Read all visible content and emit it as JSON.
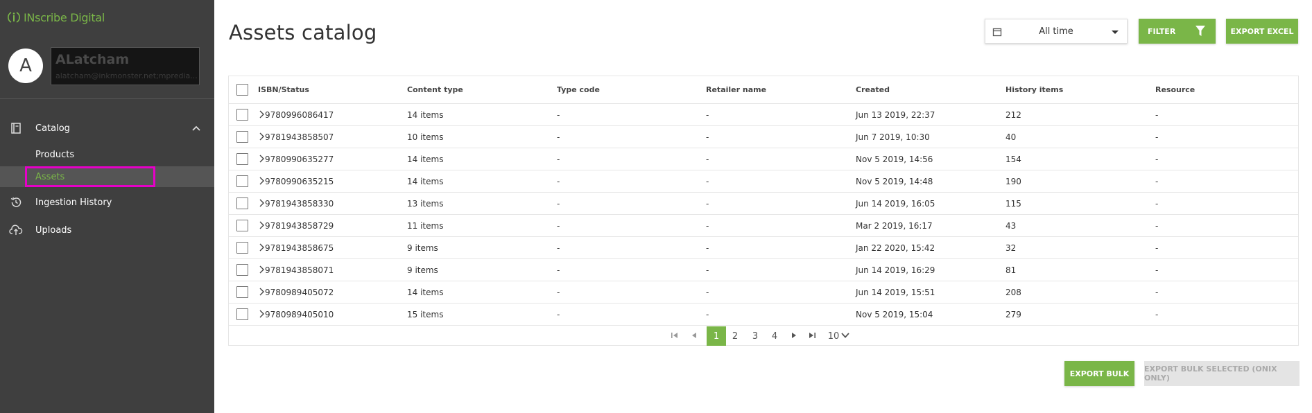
{
  "app": {
    "logo_text": "INscribe Digital",
    "accent": "#7ab648"
  },
  "user": {
    "initial": "A",
    "name": "ALatcham",
    "email": "alatcham@inkmonster.net;mpredia..."
  },
  "sidebar": {
    "catalog": "Catalog",
    "products": "Products",
    "assets": "Assets",
    "ingestion_history": "Ingestion History",
    "uploads": "Uploads"
  },
  "main": {
    "title": "Assets catalog",
    "date_filter": "All time",
    "filter_label": "FILTER",
    "export_excel_label": "EXPORT EXCEL",
    "export_bulk_label": "EXPORT BULK",
    "export_bulk_selected_label": "EXPORT BULK SELECTED (ONIX ONLY)"
  },
  "table": {
    "headers": [
      "ISBN/Status",
      "Content type",
      "Type code",
      "Retailer name",
      "Created",
      "History items",
      "Resource"
    ],
    "rows": [
      [
        "9780996086417",
        "14 items",
        "-",
        "-",
        "Jun 13 2019, 22:37",
        "212",
        "-"
      ],
      [
        "9781943858507",
        "10 items",
        "-",
        "-",
        "Jun 7 2019, 10:30",
        "40",
        "-"
      ],
      [
        "9780990635277",
        "14 items",
        "-",
        "-",
        "Nov 5 2019, 14:56",
        "154",
        "-"
      ],
      [
        "9780990635215",
        "14 items",
        "-",
        "-",
        "Nov 5 2019, 14:48",
        "190",
        "-"
      ],
      [
        "9781943858330",
        "13 items",
        "-",
        "-",
        "Jun 14 2019, 16:05",
        "115",
        "-"
      ],
      [
        "9781943858729",
        "11 items",
        "-",
        "-",
        "Mar 2 2019, 16:17",
        "43",
        "-"
      ],
      [
        "9781943858675",
        "9 items",
        "-",
        "-",
        "Jan 22 2020, 15:42",
        "32",
        "-"
      ],
      [
        "9781943858071",
        "9 items",
        "-",
        "-",
        "Jun 14 2019, 16:29",
        "81",
        "-"
      ],
      [
        "9780989405072",
        "14 items",
        "-",
        "-",
        "Jun 14 2019, 15:51",
        "208",
        "-"
      ],
      [
        "9780989405010",
        "15 items",
        "-",
        "-",
        "Nov 5 2019, 15:04",
        "279",
        "-"
      ]
    ]
  },
  "pagination": {
    "pages": [
      "1",
      "2",
      "3",
      "4"
    ],
    "current": "1",
    "page_size": "10"
  }
}
